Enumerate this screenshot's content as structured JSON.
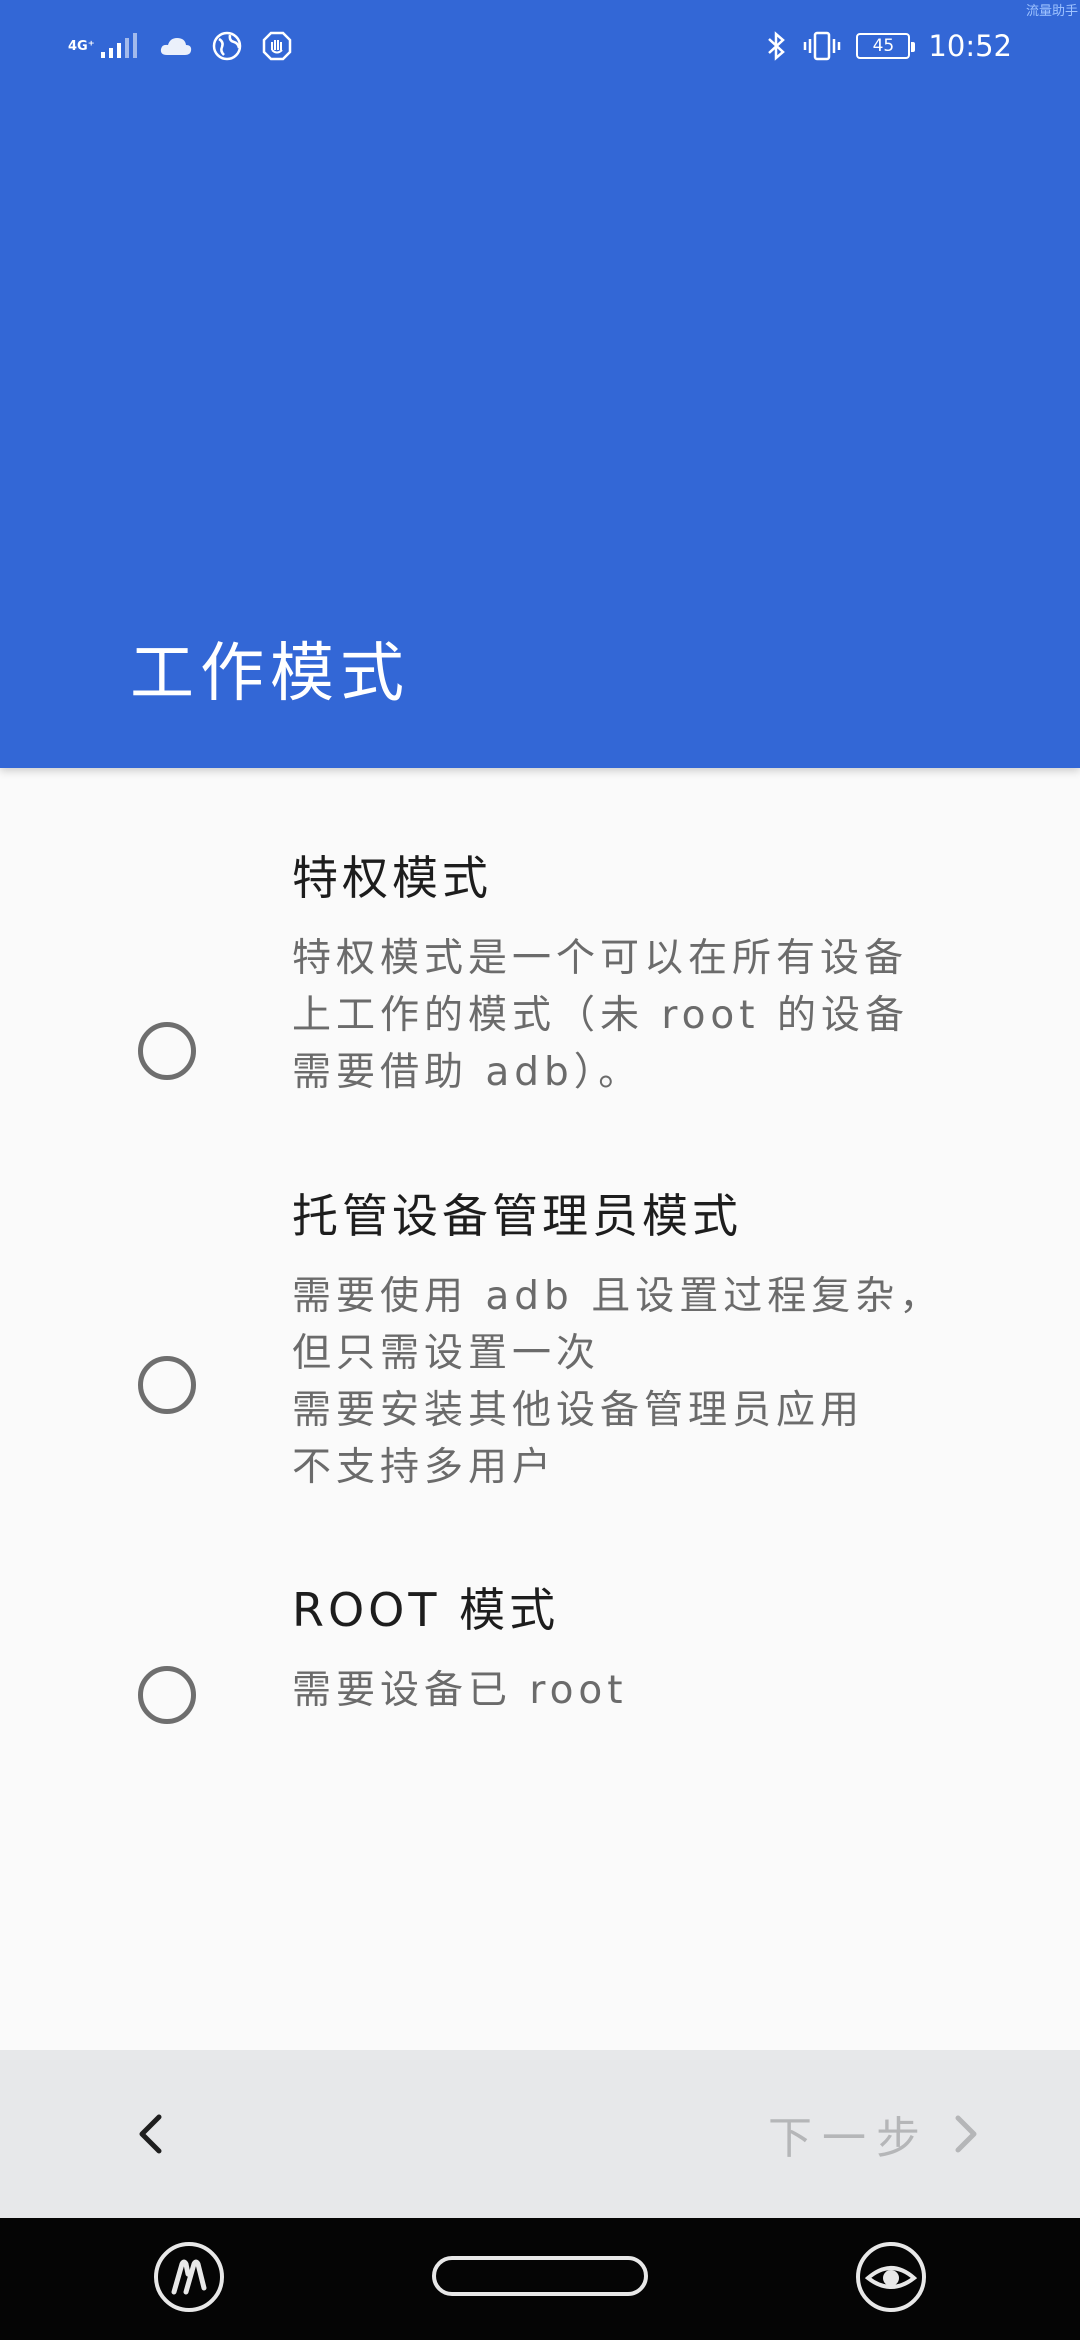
{
  "status_bar": {
    "network_label": "4G⁺",
    "battery_level": "45",
    "time": "10:52",
    "corner_tag": "流量助手",
    "icons": [
      "signal-icon",
      "cloud-icon",
      "globe-icon",
      "shield-icon",
      "bluetooth-icon",
      "vibrate-icon",
      "battery-icon"
    ]
  },
  "header": {
    "title": "工作模式",
    "background_color": "#3367d6"
  },
  "options": [
    {
      "title": "特权模式",
      "description_lines": [
        "特权模式是一个可以在所有设备",
        "上工作的模式（未 root 的设备",
        "需要借助 adb）。"
      ],
      "selected": false
    },
    {
      "title": "托管设备管理员模式",
      "description_lines": [
        "需要使用 adb 且设置过程复杂，",
        "但只需设置一次",
        "需要安装其他设备管理员应用",
        "不支持多用户"
      ],
      "selected": false
    },
    {
      "title": "ROOT 模式",
      "description_lines": [
        "需要设备已 root"
      ],
      "selected": false
    }
  ],
  "navigation": {
    "back_icon": "chevron-left-icon",
    "next_label": "下一步",
    "next_icon": "chevron-right-icon",
    "next_enabled": false
  },
  "system_nav": {
    "left_icon": "assistant-icon",
    "home_icon": "home-pill-icon",
    "right_icon": "eye-icon"
  }
}
